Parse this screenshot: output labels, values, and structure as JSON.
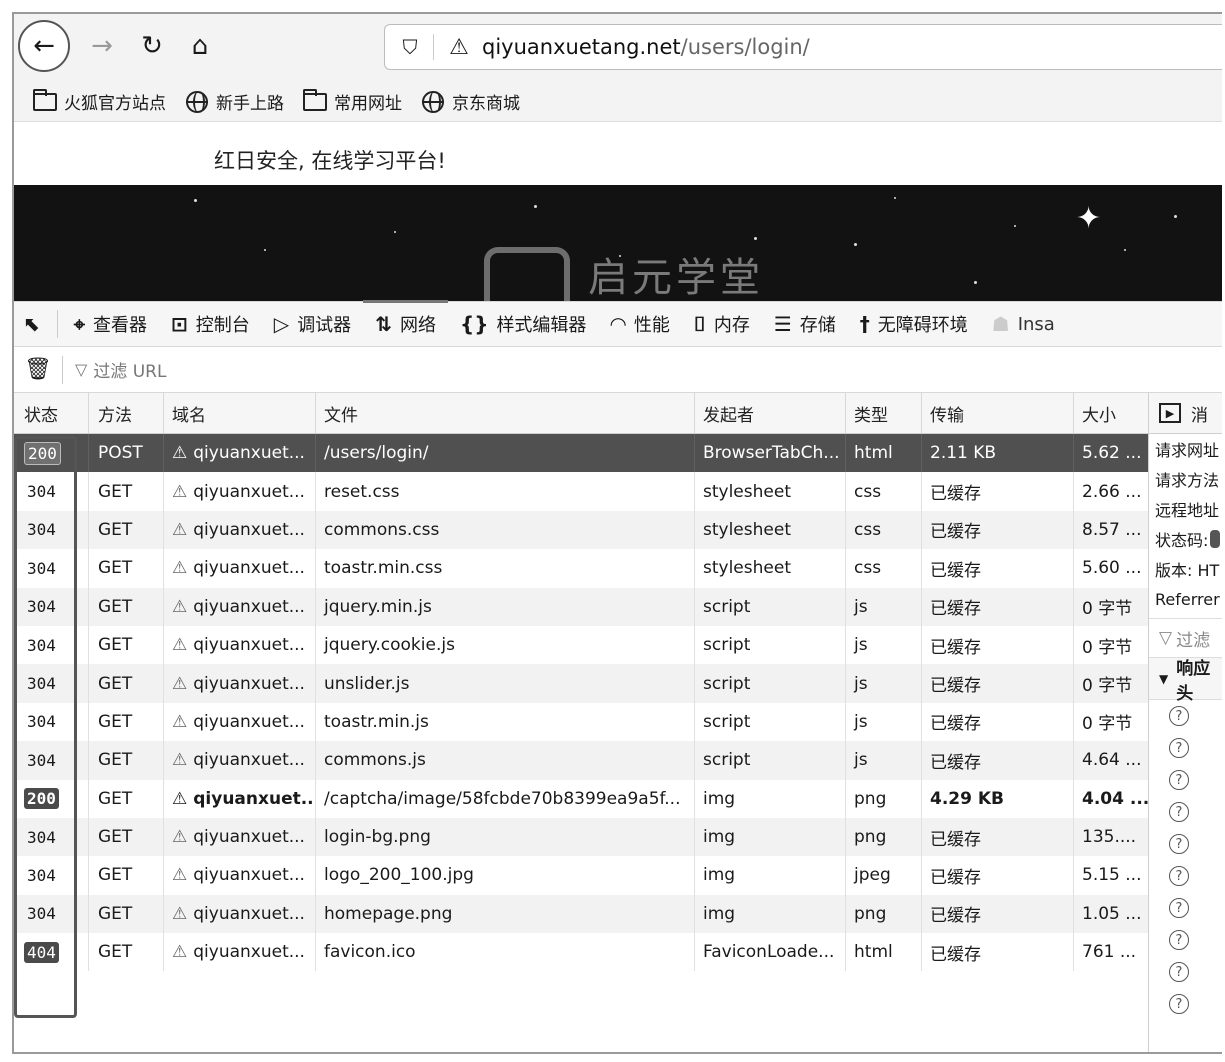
{
  "browser": {
    "url_host": "qiyuanxuetang.net",
    "url_path": "/users/login/",
    "bookmarks": [
      {
        "label": "火狐官方站点",
        "icon": "folder-icon"
      },
      {
        "label": "新手上路",
        "icon": "globe-icon"
      },
      {
        "label": "常用网址",
        "icon": "folder-icon"
      },
      {
        "label": "京东商城",
        "icon": "globe-icon"
      }
    ]
  },
  "page": {
    "slogan": "红日安全, 在线学习平台!",
    "logo_text": "启元学堂"
  },
  "devtools": {
    "tabs": [
      {
        "label": "查看器",
        "icon": "inspector-icon",
        "glyph": "⌖"
      },
      {
        "label": "控制台",
        "icon": "console-icon",
        "glyph": "⊡"
      },
      {
        "label": "调试器",
        "icon": "debugger-icon",
        "glyph": "▷"
      },
      {
        "label": "网络",
        "icon": "network-icon",
        "glyph": "⇅",
        "active": true
      },
      {
        "label": "样式编辑器",
        "icon": "style-editor-icon",
        "glyph": "{}"
      },
      {
        "label": "性能",
        "icon": "performance-icon",
        "glyph": "◠"
      },
      {
        "label": "内存",
        "icon": "memory-icon",
        "glyph": "⌷"
      },
      {
        "label": "存储",
        "icon": "storage-icon",
        "glyph": "☰"
      },
      {
        "label": "无障碍环境",
        "icon": "accessibility-icon",
        "glyph": "†"
      },
      {
        "label": "Insa",
        "icon": "extension-icon",
        "glyph": "☗"
      }
    ],
    "filter_placeholder": "过滤 URL",
    "columns": [
      "状态",
      "方法",
      "域名",
      "文件",
      "发起者",
      "类型",
      "传输",
      "大小"
    ],
    "rows": [
      {
        "status": "200",
        "method": "POST",
        "domain": "qiyuanxuet...",
        "file": "/users/login/",
        "initiator": "BrowserTabCh...",
        "type": "html",
        "transferred": "2.11 KB",
        "size": "5.62 ..."
      },
      {
        "status": "304",
        "method": "GET",
        "domain": "qiyuanxuet...",
        "file": "reset.css",
        "initiator": "stylesheet",
        "type": "css",
        "transferred": "已缓存",
        "size": "2.66 ..."
      },
      {
        "status": "304",
        "method": "GET",
        "domain": "qiyuanxuet...",
        "file": "commons.css",
        "initiator": "stylesheet",
        "type": "css",
        "transferred": "已缓存",
        "size": "8.57 ..."
      },
      {
        "status": "304",
        "method": "GET",
        "domain": "qiyuanxuet...",
        "file": "toastr.min.css",
        "initiator": "stylesheet",
        "type": "css",
        "transferred": "已缓存",
        "size": "5.60 ..."
      },
      {
        "status": "304",
        "method": "GET",
        "domain": "qiyuanxuet...",
        "file": "jquery.min.js",
        "initiator": "script",
        "type": "js",
        "transferred": "已缓存",
        "size": "0 字节"
      },
      {
        "status": "304",
        "method": "GET",
        "domain": "qiyuanxuet...",
        "file": "jquery.cookie.js",
        "initiator": "script",
        "type": "js",
        "transferred": "已缓存",
        "size": "0 字节"
      },
      {
        "status": "304",
        "method": "GET",
        "domain": "qiyuanxuet...",
        "file": "unslider.js",
        "initiator": "script",
        "type": "js",
        "transferred": "已缓存",
        "size": "0 字节"
      },
      {
        "status": "304",
        "method": "GET",
        "domain": "qiyuanxuet...",
        "file": "toastr.min.js",
        "initiator": "script",
        "type": "js",
        "transferred": "已缓存",
        "size": "0 字节"
      },
      {
        "status": "304",
        "method": "GET",
        "domain": "qiyuanxuet...",
        "file": "commons.js",
        "initiator": "script",
        "type": "js",
        "transferred": "已缓存",
        "size": "4.64 ..."
      },
      {
        "status": "200",
        "method": "GET",
        "domain": "qiyuanxuet...",
        "file": "/captcha/image/58fcbde70b8399ea9a5f...",
        "initiator": "img",
        "type": "png",
        "transferred": "4.29 KB",
        "size": "4.04 ..."
      },
      {
        "status": "304",
        "method": "GET",
        "domain": "qiyuanxuet...",
        "file": "login-bg.png",
        "initiator": "img",
        "type": "png",
        "transferred": "已缓存",
        "size": "135...."
      },
      {
        "status": "304",
        "method": "GET",
        "domain": "qiyuanxuet...",
        "file": "logo_200_100.jpg",
        "initiator": "img",
        "type": "jpeg",
        "transferred": "已缓存",
        "size": "5.15 ..."
      },
      {
        "status": "304",
        "method": "GET",
        "domain": "qiyuanxuet...",
        "file": "homepage.png",
        "initiator": "img",
        "type": "png",
        "transferred": "已缓存",
        "size": "1.05 ..."
      },
      {
        "status": "404",
        "method": "GET",
        "domain": "qiyuanxuet...",
        "file": "favicon.ico",
        "initiator": "FaviconLoade...",
        "type": "html",
        "transferred": "已缓存",
        "size": "761 ..."
      }
    ],
    "side_panel": {
      "tab_label": "消",
      "rows": [
        "请求网址",
        "请求方法",
        "远程地址",
        "状态码:",
        "版本: HT",
        "Referrer"
      ],
      "filter_placeholder": "过滤",
      "section_label": "响应头"
    }
  }
}
